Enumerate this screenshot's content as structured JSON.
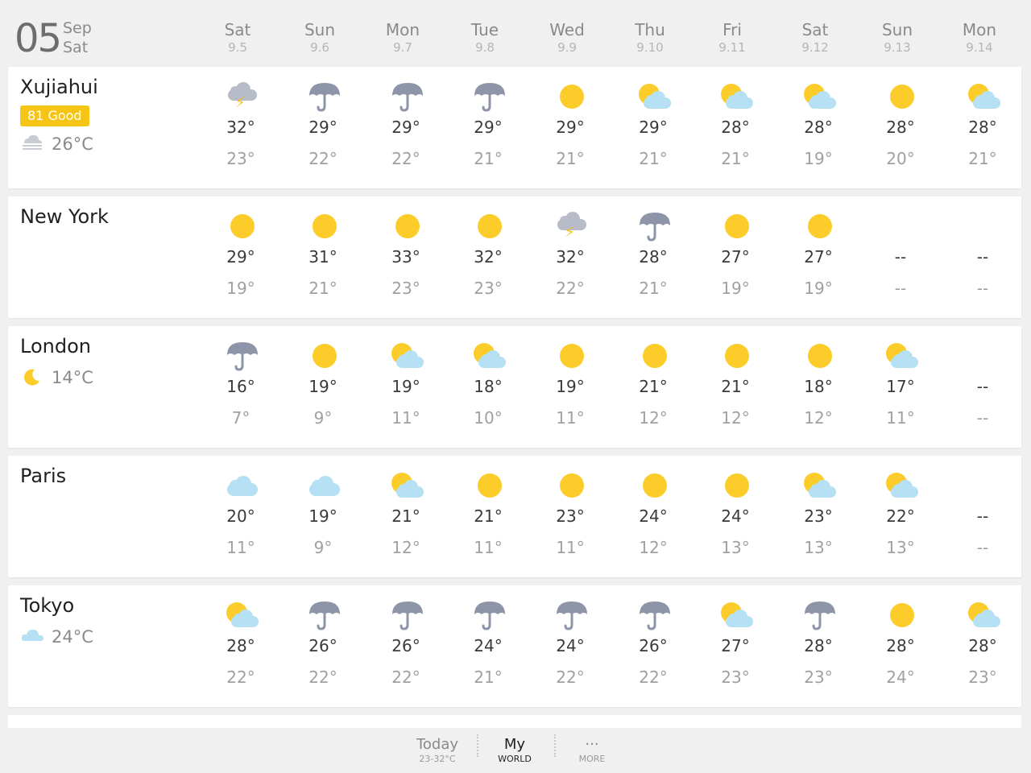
{
  "header": {
    "day": "05",
    "month": "Sep",
    "weekday": "Sat",
    "days": [
      {
        "name": "Sat",
        "date": "9.5"
      },
      {
        "name": "Sun",
        "date": "9.6"
      },
      {
        "name": "Mon",
        "date": "9.7"
      },
      {
        "name": "Tue",
        "date": "9.8"
      },
      {
        "name": "Wed",
        "date": "9.9"
      },
      {
        "name": "Thu",
        "date": "9.10"
      },
      {
        "name": "Fri",
        "date": "9.11"
      },
      {
        "name": "Sat",
        "date": "9.12"
      },
      {
        "name": "Sun",
        "date": "9.13"
      },
      {
        "name": "Mon",
        "date": "9.14"
      }
    ]
  },
  "cities": [
    {
      "name": "Xujiahui",
      "aqi": "81 Good",
      "current_icon": "fog",
      "current_temp": "26°C",
      "forecast": [
        {
          "icon": "thunderstorm",
          "hi": "32°",
          "lo": "23°"
        },
        {
          "icon": "rain",
          "hi": "29°",
          "lo": "22°"
        },
        {
          "icon": "rain",
          "hi": "29°",
          "lo": "22°"
        },
        {
          "icon": "rain",
          "hi": "29°",
          "lo": "21°"
        },
        {
          "icon": "sunny",
          "hi": "29°",
          "lo": "21°"
        },
        {
          "icon": "partly-cloudy",
          "hi": "29°",
          "lo": "21°"
        },
        {
          "icon": "partly-cloudy",
          "hi": "28°",
          "lo": "21°"
        },
        {
          "icon": "partly-cloudy",
          "hi": "28°",
          "lo": "19°"
        },
        {
          "icon": "sunny",
          "hi": "28°",
          "lo": "20°"
        },
        {
          "icon": "partly-cloudy",
          "hi": "28°",
          "lo": "21°"
        }
      ]
    },
    {
      "name": "New York",
      "aqi": "",
      "current_icon": "",
      "current_temp": "",
      "forecast": [
        {
          "icon": "sunny",
          "hi": "29°",
          "lo": "19°"
        },
        {
          "icon": "sunny",
          "hi": "31°",
          "lo": "21°"
        },
        {
          "icon": "sunny",
          "hi": "33°",
          "lo": "23°"
        },
        {
          "icon": "sunny",
          "hi": "32°",
          "lo": "23°"
        },
        {
          "icon": "thunderstorm",
          "hi": "32°",
          "lo": "22°"
        },
        {
          "icon": "rain",
          "hi": "28°",
          "lo": "21°"
        },
        {
          "icon": "sunny",
          "hi": "27°",
          "lo": "19°"
        },
        {
          "icon": "sunny",
          "hi": "27°",
          "lo": "19°"
        },
        {
          "icon": "",
          "hi": "--",
          "lo": "--"
        },
        {
          "icon": "",
          "hi": "--",
          "lo": "--"
        }
      ]
    },
    {
      "name": "London",
      "aqi": "",
      "current_icon": "moon",
      "current_temp": "14°C",
      "forecast": [
        {
          "icon": "rain",
          "hi": "16°",
          "lo": "7°"
        },
        {
          "icon": "sunny",
          "hi": "19°",
          "lo": "9°"
        },
        {
          "icon": "partly-cloudy",
          "hi": "19°",
          "lo": "11°"
        },
        {
          "icon": "partly-cloudy",
          "hi": "18°",
          "lo": "10°"
        },
        {
          "icon": "sunny",
          "hi": "19°",
          "lo": "11°"
        },
        {
          "icon": "sunny",
          "hi": "21°",
          "lo": "12°"
        },
        {
          "icon": "sunny",
          "hi": "21°",
          "lo": "12°"
        },
        {
          "icon": "sunny",
          "hi": "18°",
          "lo": "12°"
        },
        {
          "icon": "partly-cloudy",
          "hi": "17°",
          "lo": "11°"
        },
        {
          "icon": "",
          "hi": "--",
          "lo": "--"
        }
      ]
    },
    {
      "name": "Paris",
      "aqi": "",
      "current_icon": "",
      "current_temp": "",
      "forecast": [
        {
          "icon": "cloudy",
          "hi": "20°",
          "lo": "11°"
        },
        {
          "icon": "cloudy",
          "hi": "19°",
          "lo": "9°"
        },
        {
          "icon": "partly-cloudy",
          "hi": "21°",
          "lo": "12°"
        },
        {
          "icon": "sunny",
          "hi": "21°",
          "lo": "11°"
        },
        {
          "icon": "sunny",
          "hi": "23°",
          "lo": "11°"
        },
        {
          "icon": "sunny",
          "hi": "24°",
          "lo": "12°"
        },
        {
          "icon": "sunny",
          "hi": "24°",
          "lo": "13°"
        },
        {
          "icon": "partly-cloudy",
          "hi": "23°",
          "lo": "13°"
        },
        {
          "icon": "partly-cloudy",
          "hi": "22°",
          "lo": "13°"
        },
        {
          "icon": "",
          "hi": "--",
          "lo": "--"
        }
      ]
    },
    {
      "name": "Tokyo",
      "aqi": "",
      "current_icon": "cloudy",
      "current_temp": "24°C",
      "forecast": [
        {
          "icon": "partly-cloudy",
          "hi": "28°",
          "lo": "22°"
        },
        {
          "icon": "rain",
          "hi": "26°",
          "lo": "22°"
        },
        {
          "icon": "rain",
          "hi": "26°",
          "lo": "22°"
        },
        {
          "icon": "rain",
          "hi": "24°",
          "lo": "21°"
        },
        {
          "icon": "rain",
          "hi": "24°",
          "lo": "22°"
        },
        {
          "icon": "rain",
          "hi": "26°",
          "lo": "22°"
        },
        {
          "icon": "partly-cloudy",
          "hi": "27°",
          "lo": "23°"
        },
        {
          "icon": "rain",
          "hi": "28°",
          "lo": "23°"
        },
        {
          "icon": "sunny",
          "hi": "28°",
          "lo": "24°"
        },
        {
          "icon": "partly-cloudy",
          "hi": "28°",
          "lo": "23°"
        }
      ]
    }
  ],
  "tabbar": {
    "today": {
      "label": "Today",
      "sub": "23-32°C"
    },
    "my": {
      "label": "My",
      "sub": "WORLD"
    },
    "more": {
      "label": "···",
      "sub": "MORE"
    }
  },
  "colors": {
    "sun": "#fccd2a",
    "cloud": "#b6e0f3",
    "storm_cloud": "#b7bcc8",
    "umbrella": "#8e95a8",
    "aqi_badge": "#f5c414"
  }
}
